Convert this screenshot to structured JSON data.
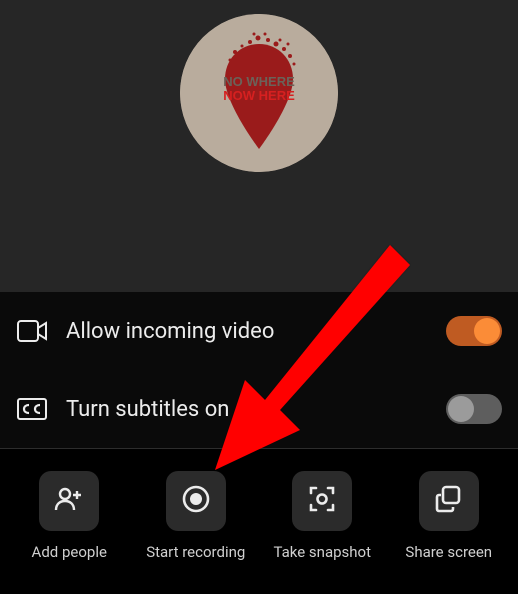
{
  "avatar": {
    "text_top": "NO WHERE",
    "text_bottom": "NOW HERE"
  },
  "settings": {
    "incoming_video": {
      "label": "Allow incoming video",
      "enabled": true
    },
    "subtitles": {
      "label": "Turn subtitles on",
      "enabled": false
    }
  },
  "actions": {
    "add_people": {
      "label": "Add people"
    },
    "start_recording": {
      "label": "Start recording"
    },
    "take_snapshot": {
      "label": "Take snapshot"
    },
    "share_screen": {
      "label": "Share screen"
    }
  }
}
